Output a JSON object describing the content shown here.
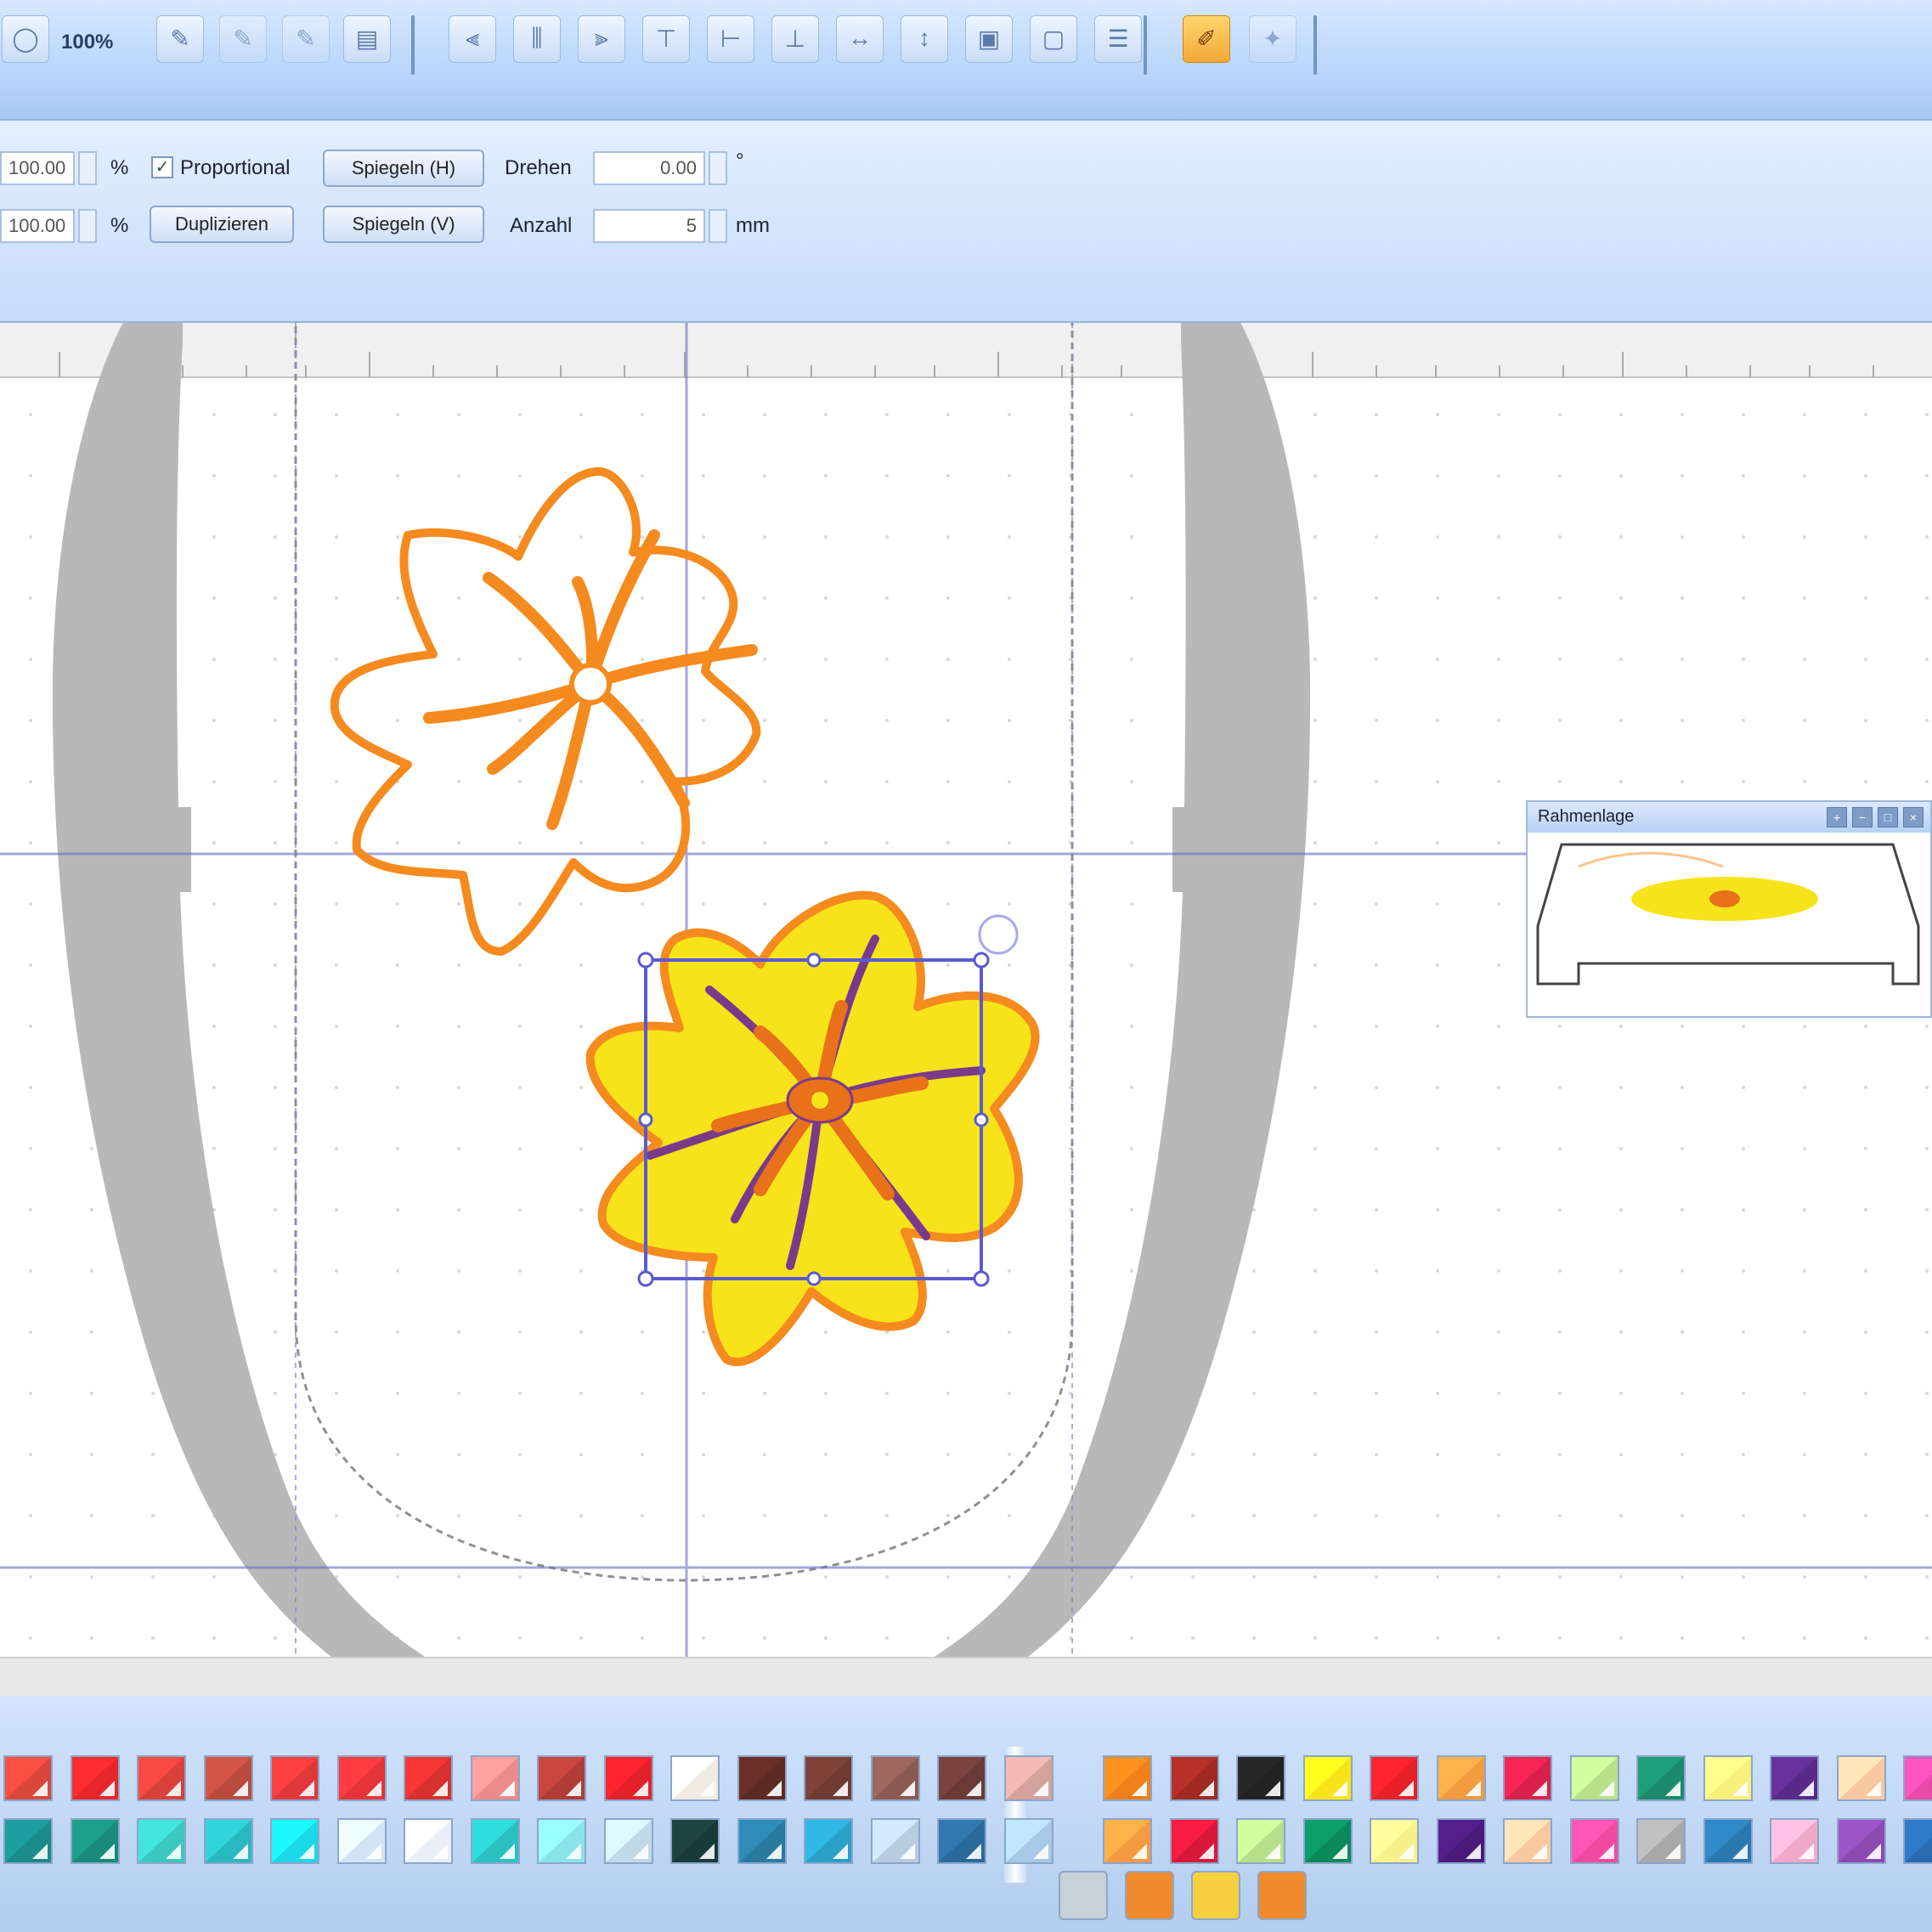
{
  "toolbar": {
    "zoom_value": "100%",
    "icons": [
      "circle-icon",
      "pen-tool-icon",
      "pen-tool-add-icon",
      "pen-tool-remove-icon",
      "text-frame-icon",
      "align-left-icon",
      "align-center-icon",
      "align-right-icon",
      "align-top-icon",
      "align-middle-icon",
      "align-bottom-icon",
      "distribute-horizontal-icon",
      "distribute-vertical-icon",
      "group-icon",
      "ungroup-icon",
      "arrange-icon",
      "color-picker-icon",
      "magic-wand-icon"
    ]
  },
  "properties": {
    "width_value": "100.00",
    "height_value": "100.00",
    "percent_unit": "%",
    "proportional_label": "Proportional",
    "proportional_checked": true,
    "duplicate_label": "Duplizieren",
    "mirror_h_label": "Spiegeln (H)",
    "mirror_v_label": "Spiegeln (V)",
    "rotate_label": "Drehen",
    "rotate_value": "0.00",
    "rotate_unit": "°",
    "count_label": "Anzahl",
    "count_value": "5",
    "count_unit": "mm"
  },
  "overview": {
    "title": "Rahmenlage"
  },
  "colors": {
    "accent": "#bcd7fb",
    "flower_outline": "#f58a1f",
    "flower_fill": "#f7e31a",
    "flower_center": "#e8711a",
    "flower_stamen": "#7a3a8a",
    "hoop_gray": "#b8b8b8",
    "guide_blue": "#6a6ac8"
  },
  "palette": {
    "row1": [
      "#d9463a",
      "#e8262a",
      "#d8403a",
      "#b84a3e",
      "#e0383a",
      "#e4343a",
      "#d8302e",
      "#ec8c8a",
      "#b03c36",
      "#e4202a",
      "#f0ebe0",
      "#5c2a22",
      "#6e3a32",
      "#8a5a52",
      "#6a3a36",
      "#d4a29c",
      "#f0801a",
      "#a02a22",
      "#222222",
      "#f7e31a",
      "#e8202a",
      "#f49a40",
      "#d8204a",
      "#b8e08a",
      "#1a8a6a",
      "#f8f07a",
      "#5a2a8a",
      "#f8c8a0",
      "#e84aa8"
    ],
    "row2": [
      "#1a8a8a",
      "#1a8a7a",
      "#3ac8c0",
      "#2ab8c0",
      "#1ad8e8",
      "#d0e4f4",
      "#e8eef8",
      "#2ac0c0",
      "#88e4e8",
      "#c0d8e8",
      "#1a3a3a",
      "#2a7aa0",
      "#2aa0c8",
      "#b8cce0",
      "#2a6a9a",
      "#a8c8e8",
      "#f49a40",
      "#d8183a",
      "#b8e08a",
      "#0a8a5a",
      "#f8f08a",
      "#4a1a7a",
      "#f8c8a0",
      "#f04aa0",
      "#a8a8a8",
      "#2a78b0",
      "#f0a8c8",
      "#8a4ab0",
      "#2a6ab0"
    ],
    "bottom_tools": [
      "#c8d0da",
      "#f08a2a",
      "#f7d040",
      "#f08a2a"
    ]
  }
}
